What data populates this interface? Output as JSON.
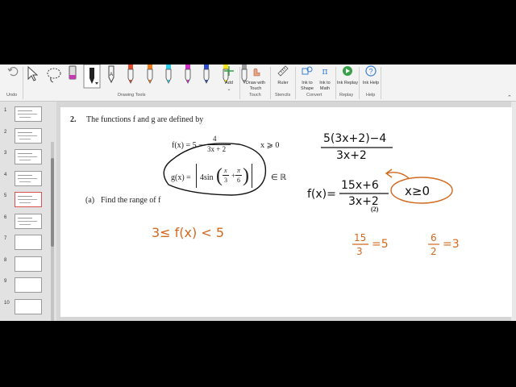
{
  "ribbon": {
    "undo_label": "Undo",
    "drawing_tools_label": "Drawing Tools",
    "add_label": "Add",
    "draw_with_touch_label": "Draw with Touch",
    "touch_label": "Touch",
    "ruler_label": "Ruler",
    "stencils_label": "Stencils",
    "ink_to_shape_label": "Ink to Shape",
    "ink_to_math_label": "Ink to Math",
    "convert_label": "Convert",
    "ink_replay_label": "Ink Replay",
    "replay_label": "Replay",
    "ink_help_label": "Ink Help",
    "help_label": "Help",
    "pens": [
      {
        "name": "black-pen",
        "color": "#111111"
      },
      {
        "name": "red-pen",
        "color": "#e04a2a"
      },
      {
        "name": "orange-pen",
        "color": "#f07b1c"
      },
      {
        "name": "cyan-pen",
        "color": "#2fc9e8"
      },
      {
        "name": "magenta-pen",
        "color": "#d02fc4"
      },
      {
        "name": "blue-pen",
        "color": "#2a4bd0"
      },
      {
        "name": "yellow-highlighter",
        "color": "#f2e21a"
      },
      {
        "name": "gray-pen",
        "color": "#9a9a9a"
      }
    ]
  },
  "slides": {
    "numbers": [
      "1",
      "2",
      "3",
      "4",
      "5",
      "6",
      "7",
      "8",
      "9",
      "10"
    ],
    "selected": 5
  },
  "question": {
    "number": "2.",
    "intro": "The functions f and g are defined by",
    "f_lhs": "f(x) = 5 −",
    "f_num": "4",
    "f_den": "3x + 2",
    "f_domain": "x ⩾ 0",
    "g_lhs": "g(x) =",
    "g_abs_left": "4sin",
    "g_x_over": "x",
    "g_x_under": "3",
    "g_plus": "+",
    "g_pi_over": "π",
    "g_pi_under": "6",
    "g_domain": "∈ ℝ",
    "part_a_label": "(a)",
    "part_a_text": "Find the range of f",
    "marks": "(2)"
  },
  "handwriting": {
    "range_answer": "3≤ f(x) < 5",
    "work_top_num": "5(3x+2)−4",
    "work_top_den": "3x+2",
    "fx_label": "f(x)=",
    "fx_num": "15x+6",
    "fx_den": "3x+2",
    "domain_note": "x≥0",
    "ratio1_num": "15",
    "ratio1_den": "3",
    "ratio1_result": "=5",
    "ratio2_num": "6",
    "ratio2_den": "2",
    "ratio2_result": "=3",
    "ink_color": "#d2691e"
  }
}
